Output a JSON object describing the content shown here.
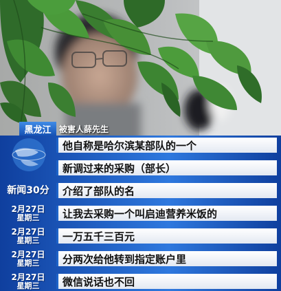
{
  "region_tag": "黑龙江",
  "speaker_label": "被害人薛先生",
  "program_label": "新闻30分",
  "date_tag": {
    "date": "2月27日",
    "weekday": "星期三"
  },
  "subtitles": [
    "他自称是哈尔滨某部队的一个",
    "新调过来的采购（部长）",
    "介绍了部队的名",
    "让我去采购一个叫启迪营养米饭的",
    "一万五千三百元",
    "分两次给他转到指定账户里",
    "微信说话也不回"
  ],
  "colors": {
    "accent_blue": "#1d63c8",
    "bar_white": "#ffffff",
    "text_dark": "#111111"
  }
}
